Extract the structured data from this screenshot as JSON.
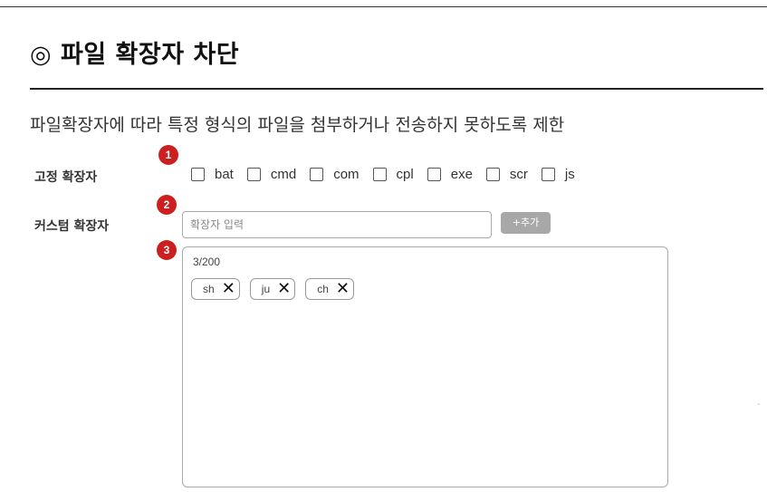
{
  "title": "◎ 파일 확장자 차단",
  "description": "파일확장자에 따라 특정 형식의 파일을 첨부하거나 전송하지 못하도록 제한",
  "badges": [
    "1",
    "2",
    "3"
  ],
  "fixed": {
    "label": "고정 확장자",
    "extensions": [
      {
        "name": "bat",
        "checked": false
      },
      {
        "name": "cmd",
        "checked": false
      },
      {
        "name": "com",
        "checked": false
      },
      {
        "name": "cpl",
        "checked": false
      },
      {
        "name": "exe",
        "checked": false
      },
      {
        "name": "scr",
        "checked": false
      },
      {
        "name": "js",
        "checked": false
      }
    ]
  },
  "custom": {
    "label": "커스텀 확장자",
    "placeholder": "확장자 입력",
    "add_button": "+추가",
    "count": "3/200",
    "tags": [
      "sh",
      "ju",
      "ch"
    ],
    "remove_glyph": "✕"
  },
  "colors": {
    "badge": "#cc1f1f",
    "add_button_bg": "#a8a8a8"
  }
}
